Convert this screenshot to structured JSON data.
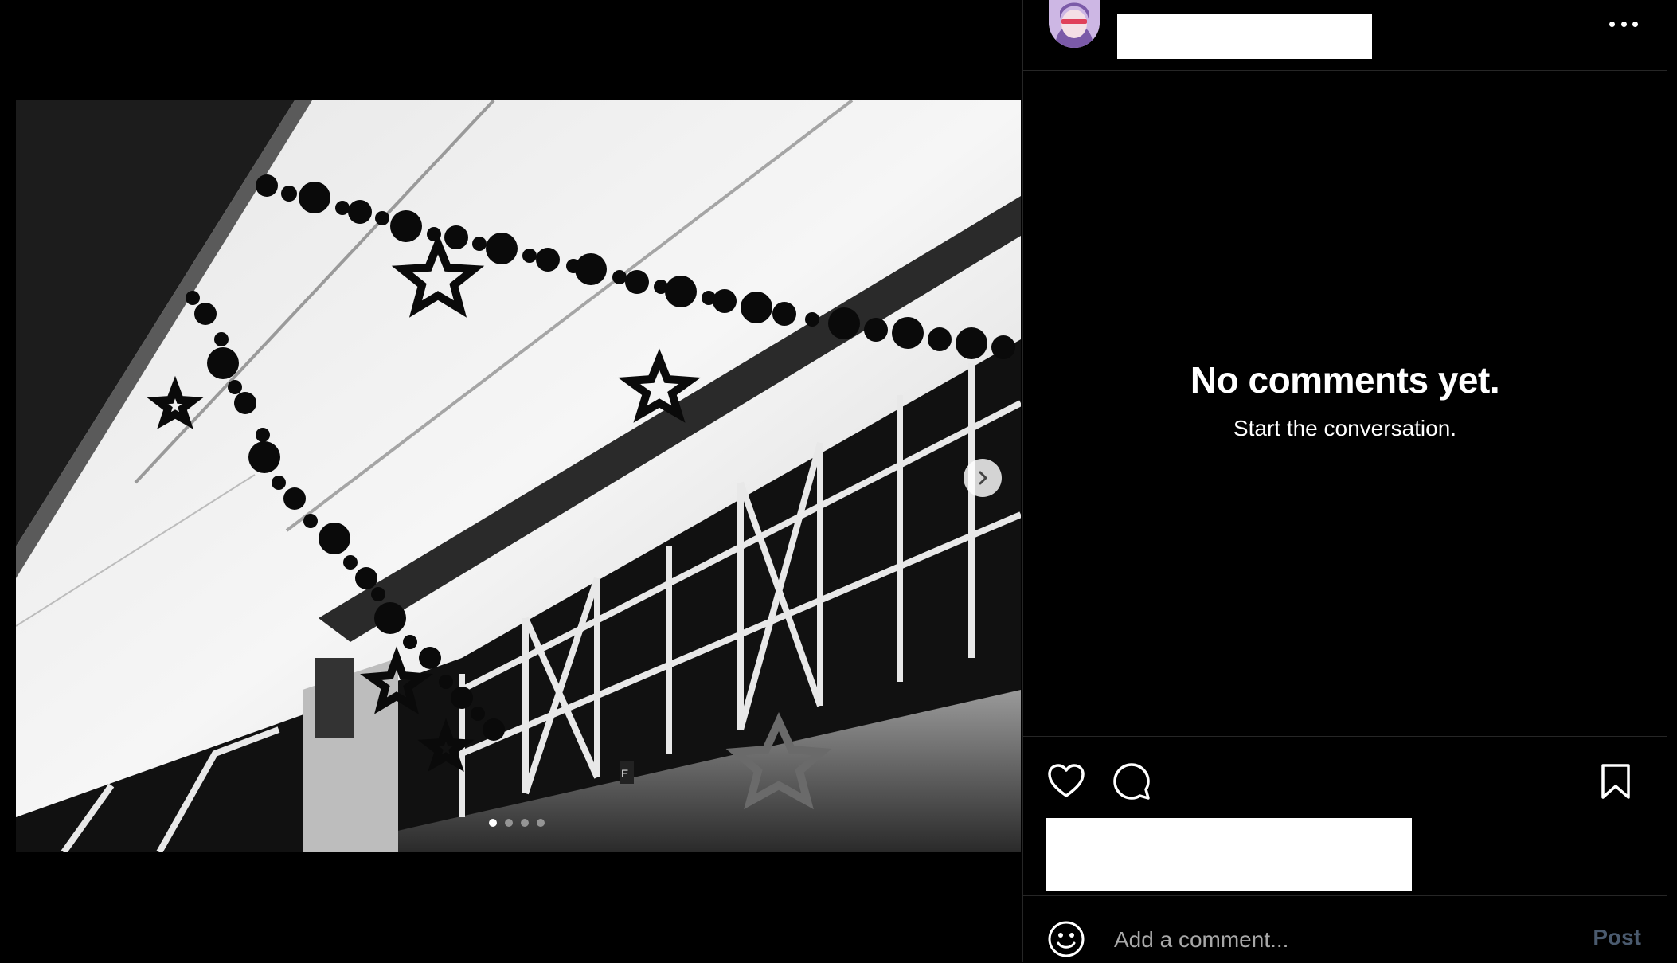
{
  "post": {
    "username": "",
    "media": {
      "slide_count": 4,
      "current_slide": 1,
      "alt_description": "",
      "icons": {
        "next": "chevron-right-icon"
      }
    }
  },
  "comments": {
    "empty_title": "No comments yet.",
    "empty_subtitle": "Start the conversation."
  },
  "actions": {
    "icons": [
      "heart-icon",
      "comment-icon",
      "bookmark-icon"
    ]
  },
  "comment_box": {
    "placeholder": "Add a comment...",
    "post_label": "Post",
    "post_color": "#4a5a6e"
  },
  "colors": {
    "background": "#000000",
    "divider": "#262626",
    "text": "#ffffff",
    "muted": "#a8a8a8"
  }
}
